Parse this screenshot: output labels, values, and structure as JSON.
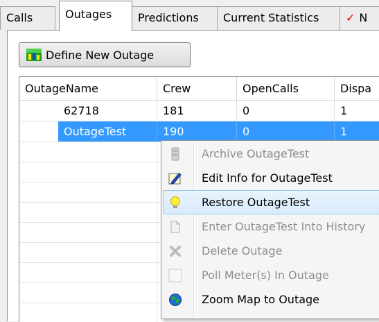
{
  "tabs": [
    {
      "label": "Calls",
      "active": false
    },
    {
      "label": "Outages",
      "active": true
    },
    {
      "label": "Predictions",
      "active": false
    },
    {
      "label": "Current Statistics",
      "active": false
    },
    {
      "label": "N",
      "active": false
    }
  ],
  "toolbar": {
    "define_label": "Define New Outage",
    "define_icon": "define-outage-icon"
  },
  "grid": {
    "columns": [
      "OutageName",
      "Crew",
      "OpenCalls",
      "Dispa"
    ],
    "rows": [
      {
        "name": "62718",
        "crew": "181",
        "open_calls": "0",
        "dispatched": "1",
        "selected": false
      },
      {
        "name": "OutageTest",
        "crew": "190",
        "open_calls": "0",
        "dispatched": "1",
        "selected": true
      }
    ]
  },
  "context_menu": {
    "items": [
      {
        "label": "Archive OutageTest",
        "icon": "archive-icon",
        "enabled": false
      },
      {
        "label": "Edit Info for OutageTest",
        "icon": "edit-icon",
        "enabled": true
      },
      {
        "label": "Restore OutageTest",
        "icon": "lightbulb-icon",
        "enabled": true,
        "hover": true
      },
      {
        "label": "Enter OutageTest Into History",
        "icon": "document-icon",
        "enabled": false
      },
      {
        "label": "Delete Outage",
        "icon": "delete-icon",
        "enabled": false
      },
      {
        "label": "Poll Meter(s) In Outage",
        "icon": "poll-icon",
        "enabled": false
      },
      {
        "label": "Zoom Map to Outage",
        "icon": "globe-icon",
        "enabled": true
      }
    ]
  },
  "colors": {
    "selection": "#3399ff",
    "menu_hover_border": "#99c9ef",
    "flag": "#e00000"
  }
}
